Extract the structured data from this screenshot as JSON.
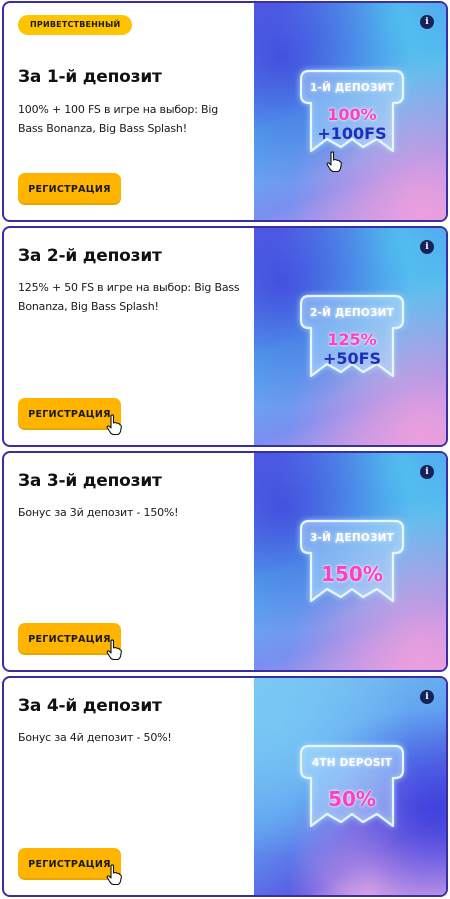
{
  "cards": [
    {
      "badge": "ПРИВЕТСТВЕННЫЙ",
      "title": "За 1-й депозит",
      "description": "100% + 100 FS в игре на выбор: Big Bass Bonanza, Big Bass Splash!",
      "button": "РЕГИСТРАЦИЯ",
      "info": "i",
      "promo_label": "1-Й ДЕПОЗИТ",
      "promo_line1": "100%",
      "promo_line2": "+100FS"
    },
    {
      "title": "За 2-й депозит",
      "description": "125% + 50 FS в игре на выбор: Big Bass Bonanza, Big Bass Splash!",
      "button": "РЕГИСТРАЦИЯ",
      "info": "i",
      "promo_label": "2-Й ДЕПОЗИТ",
      "promo_line1": "125%",
      "promo_line2": "+50FS"
    },
    {
      "title": "За 3-й депозит",
      "description": "Бонус за 3й депозит - 150%!",
      "button": "РЕГИСТРАЦИЯ",
      "info": "i",
      "promo_label": "3-Й ДЕПОЗИТ",
      "promo_line1": "150%"
    },
    {
      "title": "За 4-й депозит",
      "description": "Бонус за 4й депозит - 50%!",
      "button": "РЕГИСТРАЦИЯ",
      "info": "i",
      "promo_label": "4TH DEPOSIT",
      "promo_line1": "50%"
    }
  ],
  "colors": {
    "card_border": "#3a2fa0",
    "badge_bg": "#ffc400",
    "button_bg": "#ffb400",
    "promo_pink": "#ff3ec0",
    "promo_blue": "#1e2fb8",
    "info_bg": "#15235a"
  },
  "icons": {
    "info": "info-icon",
    "cursor": "hand-cursor-icon",
    "frame": "cat-frame-icon"
  }
}
